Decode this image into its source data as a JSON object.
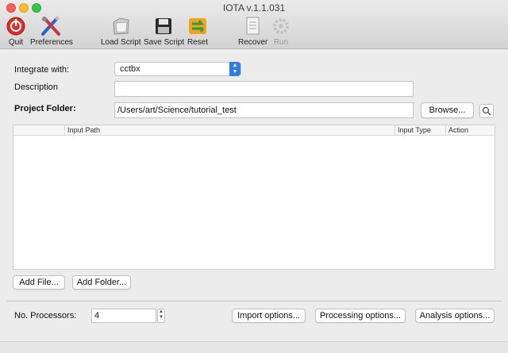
{
  "window": {
    "title": "IOTA v.1.1.031"
  },
  "toolbar": [
    {
      "label": "Quit",
      "icon": "quit-icon"
    },
    {
      "label": "Preferences",
      "icon": "preferences-icon"
    },
    {
      "label": "Load Script",
      "icon": "load-script-icon"
    },
    {
      "label": "Save Script",
      "icon": "save-script-icon"
    },
    {
      "label": "Reset",
      "icon": "reset-icon"
    },
    {
      "label": "Recover",
      "icon": "recover-icon"
    },
    {
      "label": "Run",
      "icon": "run-icon",
      "disabled": true
    }
  ],
  "form": {
    "integrate_label": "Integrate with:",
    "integrate_value": "cctbx",
    "description_label": "Description",
    "description_value": "",
    "project_folder_label": "Project Folder:",
    "project_folder_value": "/Users/art/Science/tutorial_test",
    "browse_label": "Browse..."
  },
  "table": {
    "columns": [
      "Input Path",
      "Input Type",
      "Action"
    ],
    "rows": []
  },
  "buttons": {
    "add_file": "Add File...",
    "add_folder": "Add Folder..."
  },
  "footer": {
    "processors_label": "No. Processors:",
    "processors_value": "4",
    "import_options": "Import options...",
    "processing_options": "Processing options...",
    "analysis_options": "Analysis options..."
  },
  "colors": {
    "accent": "#2f7de1",
    "quit_red": "#e02b2b",
    "reset_green": "#3aa845"
  }
}
